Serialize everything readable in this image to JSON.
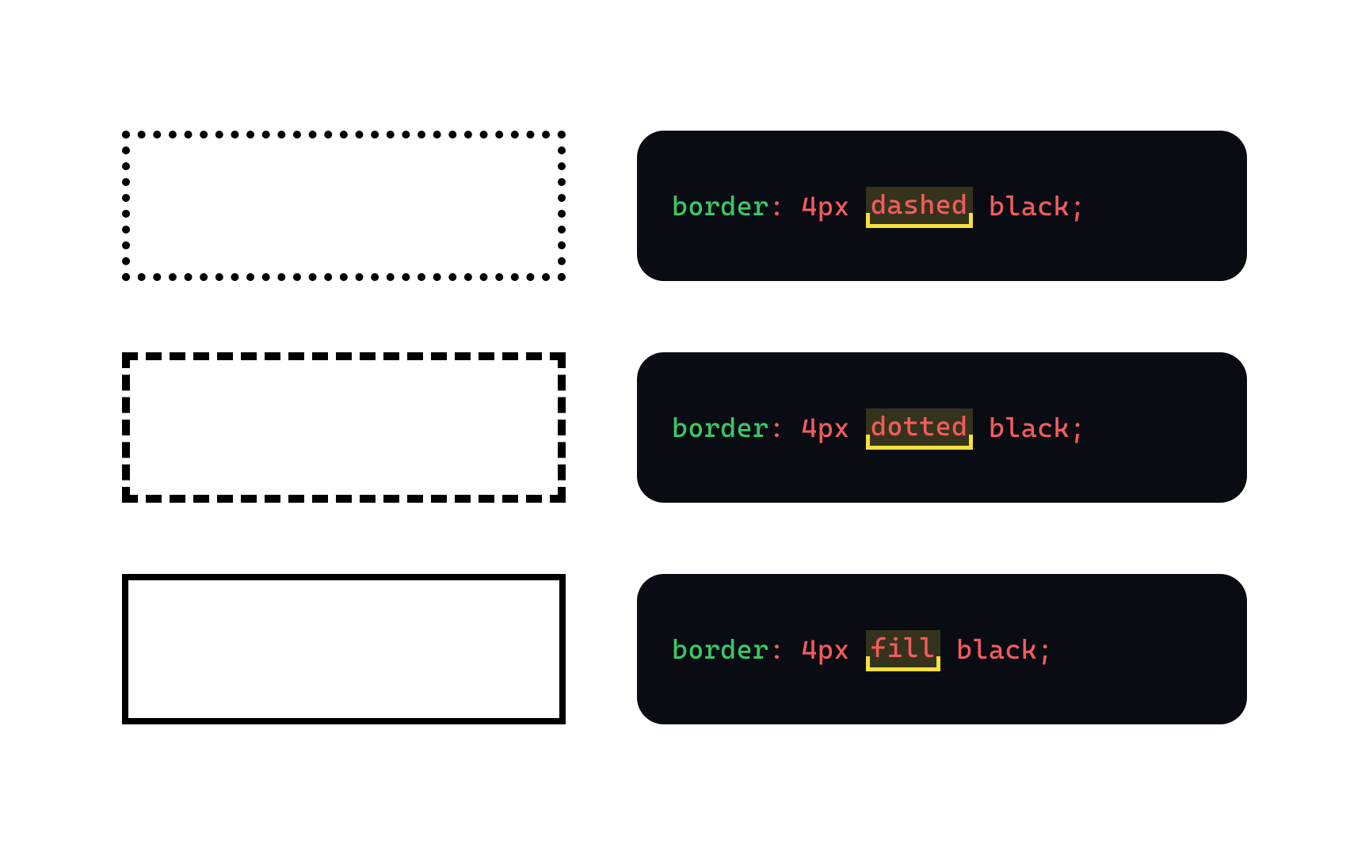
{
  "rows": [
    {
      "example_class": "ex-dotted",
      "example_name": "dotted-border-example",
      "code_name": "code-block-dashed",
      "prop": "border",
      "colon": ":",
      "space": " ",
      "size": "4px",
      "highlight": "dashed",
      "color": "black",
      "semi": ";"
    },
    {
      "example_class": "ex-dashed",
      "example_name": "dashed-border-example",
      "code_name": "code-block-dotted",
      "prop": "border",
      "colon": ":",
      "space": " ",
      "size": "4px",
      "highlight": "dotted",
      "color": "black",
      "semi": ";"
    },
    {
      "example_class": "ex-solid",
      "example_name": "solid-border-example",
      "code_name": "code-block-fill",
      "prop": "border",
      "colon": ":",
      "space": " ",
      "size": "4px",
      "highlight": "fill",
      "color": "black",
      "semi": ";"
    }
  ]
}
